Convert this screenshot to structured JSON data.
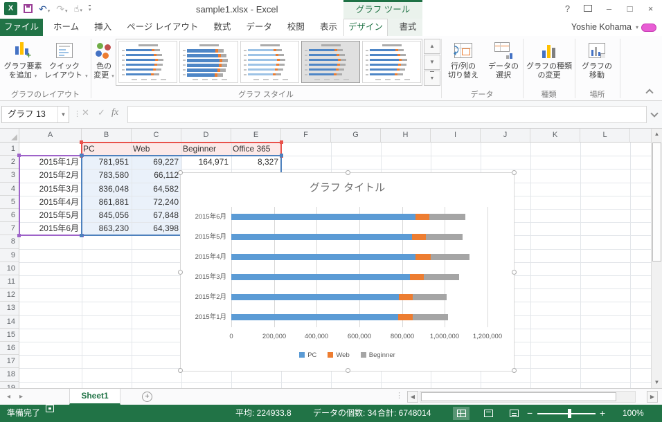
{
  "titlebar": {
    "title": "sample1.xlsx - Excel",
    "contextual_group": "グラフ ツール",
    "qat": {
      "excel_logo": "X"
    },
    "window": {
      "help": "?",
      "minimize": "–",
      "maximize": "□",
      "close": "×"
    }
  },
  "tab_row": {
    "file_tab": "ファイル",
    "tabs": [
      "ホーム",
      "挿入",
      "ページ レイアウト",
      "数式",
      "データ",
      "校閲",
      "表示"
    ],
    "contextual_tabs": [
      "デザイン",
      "書式"
    ],
    "active_tab": "デザイン",
    "user_name": "Yoshie Kohama"
  },
  "ribbon": {
    "groups": [
      {
        "label": "グラフのレイアウト",
        "buttons": [
          {
            "lines": [
              "グラフ要素",
              "を追加"
            ]
          },
          {
            "lines": [
              "クイック",
              "レイアウト"
            ]
          }
        ]
      },
      {
        "label": "グラフ スタイル",
        "buttons": [
          {
            "lines": [
              "色の",
              "変更"
            ]
          }
        ],
        "gallery": {
          "style_count": 5,
          "selected_index": 3
        }
      },
      {
        "label": "データ",
        "buttons": [
          {
            "lines": [
              "行/列の",
              "切り替え"
            ]
          },
          {
            "lines": [
              "データの",
              "選択"
            ]
          }
        ]
      },
      {
        "label": "種類",
        "buttons": [
          {
            "lines": [
              "グラフの種類",
              "の変更"
            ]
          }
        ]
      },
      {
        "label": "場所",
        "buttons": [
          {
            "lines": [
              "グラフの",
              "移動"
            ]
          }
        ]
      }
    ]
  },
  "formula_bar": {
    "name_box": "グラフ 13",
    "fx_label": "fx",
    "formula_value": ""
  },
  "grid": {
    "visible_columns": [
      "A",
      "B",
      "C",
      "D",
      "E",
      "F",
      "G",
      "H",
      "I",
      "J",
      "K",
      "L"
    ],
    "visible_row_count": 19
  },
  "table": {
    "headers": [
      {
        "col": "B",
        "text": "PC"
      },
      {
        "col": "C",
        "text": "Web"
      },
      {
        "col": "D",
        "text": "Beginner"
      },
      {
        "col": "E",
        "text": "Office 365"
      }
    ],
    "rows": [
      {
        "row": 2,
        "A": "2015年1月",
        "B": "781,951",
        "C": "69,227",
        "D": "164,971",
        "E": "8,327"
      },
      {
        "row": 3,
        "A": "2015年2月",
        "B": "783,580",
        "C": "66,112"
      },
      {
        "row": 4,
        "A": "2015年3月",
        "B": "836,048",
        "C": "64,582"
      },
      {
        "row": 5,
        "A": "2015年4月",
        "B": "861,881",
        "C": "72,240"
      },
      {
        "row": 6,
        "A": "2015年5月",
        "B": "845,056",
        "C": "67,848"
      },
      {
        "row": 7,
        "A": "2015年6月",
        "B": "863,230",
        "C": "64,398"
      }
    ]
  },
  "selection": {
    "header_range": "B1:E1",
    "header_range_color": "#E8514B",
    "header_fill": "#FCE9E8",
    "category_range": "A2:A7",
    "category_range_color": "#9E63C9",
    "value_range": "B2:E7",
    "value_range_color": "#4E81BD",
    "value_fill": "#EAF1FA"
  },
  "chart_data": {
    "type": "bar",
    "orientation": "horizontal",
    "stacked": true,
    "title": "グラフ タイトル",
    "categories": [
      "2015年6月",
      "2015年5月",
      "2015年4月",
      "2015年3月",
      "2015年2月",
      "2015年1月"
    ],
    "series": [
      {
        "name": "PC",
        "color": "#5B9BD5",
        "values": [
          863230,
          845056,
          861881,
          836048,
          783580,
          781951
        ]
      },
      {
        "name": "Web",
        "color": "#ED7D31",
        "values": [
          64398,
          67848,
          72240,
          64582,
          66112,
          69227
        ]
      },
      {
        "name": "Beginner",
        "color": "#A5A5A5",
        "values": [
          168000,
          170000,
          180000,
          166000,
          158000,
          164971
        ]
      }
    ],
    "x_axis": {
      "min": 0,
      "max": 1200000,
      "step": 200000,
      "tick_labels": [
        "0",
        "200,000",
        "400,000",
        "600,000",
        "800,000",
        "1,000,000",
        "1,200,000"
      ]
    },
    "legend": {
      "position": "bottom"
    },
    "gridlines": true
  },
  "sheet_bar": {
    "tabs": [
      "Sheet1"
    ],
    "active_tab": "Sheet1",
    "add_button": "+"
  },
  "status_bar": {
    "ready": "準備完了",
    "average": "平均: 224933.8",
    "count": "データの個数: 34",
    "sum": "合計: 6748014",
    "zoom_level": "100%"
  }
}
